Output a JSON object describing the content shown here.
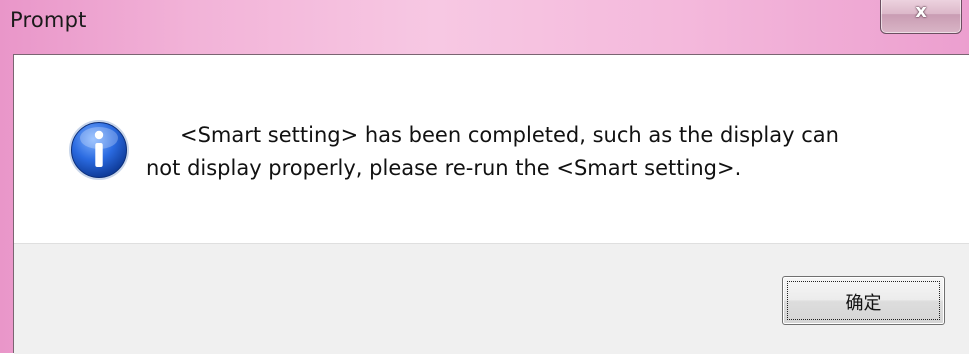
{
  "window": {
    "title": "Prompt",
    "close_glyph": "x"
  },
  "dialog": {
    "icon": "info-icon",
    "message_line1": "<Smart setting> has been completed, such as the display can",
    "message_line2": "not display properly, please re-run the <Smart setting>."
  },
  "buttons": {
    "ok_label": "确定"
  },
  "colors": {
    "titlebar": "#f2b3d8",
    "close_button": "#d9b5c6",
    "content_bg": "#ffffff",
    "footer_bg": "#f0f0f0",
    "info_icon": "#1f5fd1"
  }
}
